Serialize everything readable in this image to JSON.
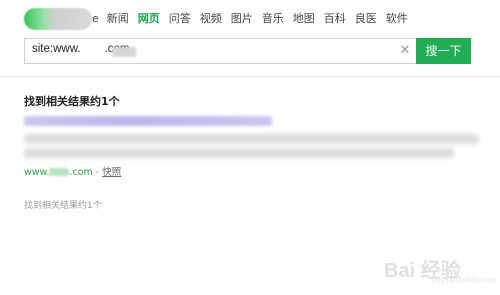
{
  "nav": {
    "partial_label": "e",
    "items": [
      {
        "label": "新闻",
        "active": false
      },
      {
        "label": "网页",
        "active": true
      },
      {
        "label": "问答",
        "active": false
      },
      {
        "label": "视频",
        "active": false
      },
      {
        "label": "图片",
        "active": false
      },
      {
        "label": "音乐",
        "active": false
      },
      {
        "label": "地图",
        "active": false
      },
      {
        "label": "百科",
        "active": false
      },
      {
        "label": "良医",
        "active": false
      },
      {
        "label": "软件",
        "active": false
      }
    ]
  },
  "search": {
    "query_prefix": "site:www.",
    "query_suffix": ".com",
    "button_label": "搜一下",
    "clear_icon": "close-icon"
  },
  "results": {
    "count_text": "找到相关结果约1个",
    "items": [
      {
        "url_prefix": "www.",
        "url_suffix": ".com",
        "separator": " - ",
        "snapshot_label": "快照"
      }
    ],
    "footer_count_text": "找到相关结果约1个"
  },
  "watermark": {
    "text": "Bai 经验",
    "sub": "jingyan.baidu.com"
  },
  "colors": {
    "accent": "#1fa24b",
    "button": "#1fac52",
    "url_green": "#2e9a45"
  }
}
